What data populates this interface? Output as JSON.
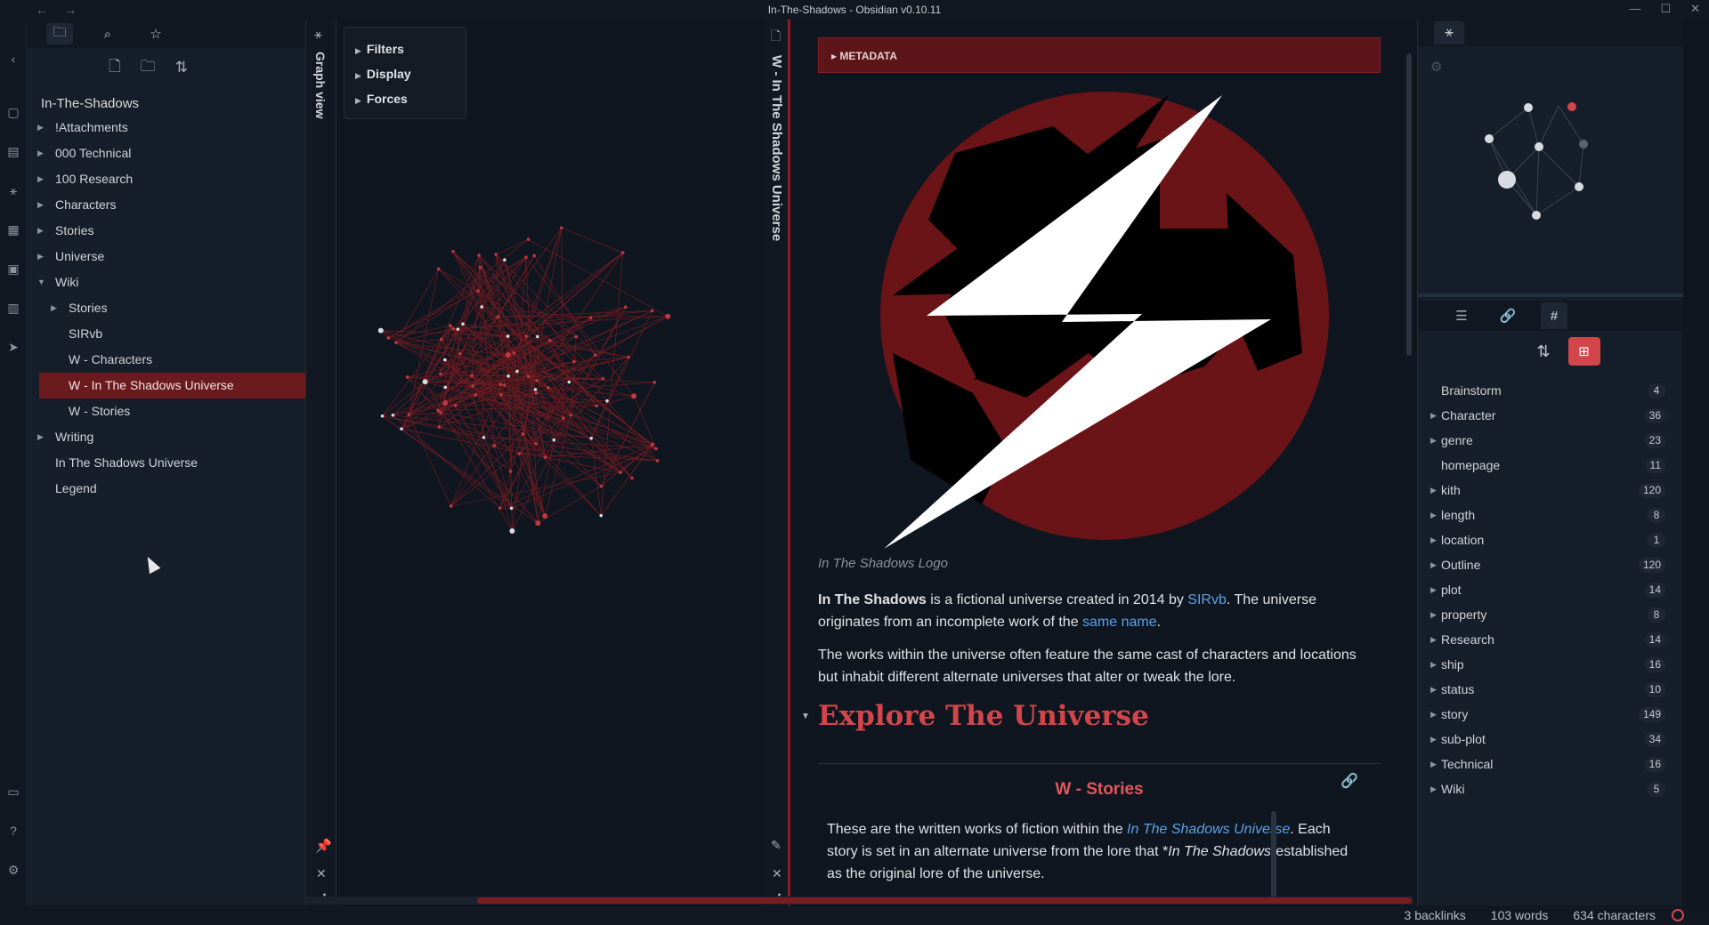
{
  "window": {
    "title": "In-The-Shadows - Obsidian v0.10.11",
    "nav_back": "←",
    "nav_forward": "→",
    "minimize": "—",
    "maximize": "☐",
    "close": "✕"
  },
  "ribbon": {
    "icons": [
      "chevron-left-icon",
      "calendar-icon",
      "document-icon",
      "graph-icon",
      "plugin-icon",
      "template-icon",
      "kanban-icon",
      "publish-icon",
      "vault-icon",
      "help-icon",
      "settings-icon"
    ]
  },
  "left_panel": {
    "tabs": [
      "file-explorer",
      "search",
      "starred"
    ],
    "vault_name": "In-The-Shadows",
    "tree": [
      {
        "label": "!Attachments",
        "level": 1,
        "folder": true,
        "expanded": false
      },
      {
        "label": "000 Technical",
        "level": 1,
        "folder": true,
        "expanded": false
      },
      {
        "label": "100 Research",
        "level": 1,
        "folder": true,
        "expanded": false
      },
      {
        "label": "Characters",
        "level": 1,
        "folder": true,
        "expanded": false
      },
      {
        "label": "Stories",
        "level": 1,
        "folder": true,
        "expanded": false
      },
      {
        "label": "Universe",
        "level": 1,
        "folder": true,
        "expanded": false
      },
      {
        "label": "Wiki",
        "level": 1,
        "folder": true,
        "expanded": true
      },
      {
        "label": "Stories",
        "level": 2,
        "folder": true,
        "expanded": false
      },
      {
        "label": "SIRvb",
        "level": 2,
        "folder": false
      },
      {
        "label": "W - Characters",
        "level": 2,
        "folder": false
      },
      {
        "label": "W - In The Shadows Universe",
        "level": 2,
        "folder": false,
        "active": true
      },
      {
        "label": "W - Stories",
        "level": 2,
        "folder": false
      },
      {
        "label": "Writing",
        "level": 1,
        "folder": true,
        "expanded": false
      },
      {
        "label": "In The Shadows Universe",
        "level": 1,
        "folder": false
      },
      {
        "label": "Legend",
        "level": 1,
        "folder": false
      }
    ]
  },
  "graph_view": {
    "title": "Graph view",
    "controls": [
      "Filters",
      "Display",
      "Forces"
    ]
  },
  "note": {
    "tab_title": "W - In The Shadows Universe",
    "metadata_label": "METADATA",
    "image_caption": "In The Shadows Logo",
    "p1": {
      "bold": "In The Shadows",
      "t1": " is a fictional universe created in 2014 by ",
      "link1": "SIRvb",
      "t2": ". The universe originates from an incomplete work of the ",
      "link2": "same name",
      "t3": "."
    },
    "p2": "The works within the universe often feature the same cast of characters and locations but inhabit different alternate universes that alter or tweak the lore.",
    "h1": "Explore The Universe",
    "embed_title": "W - Stories",
    "p3": {
      "t1": "These are the written works of fiction within the ",
      "link": "In The Shadows Universe",
      "t2": ". Each story is set in an alternate universe from the lore that *",
      "em": "In The Shadows",
      "t3": "-established as the original lore of the universe."
    }
  },
  "right_panel": {
    "tags_title": "Tags",
    "tags": [
      {
        "name": "Brainstorm",
        "count": "4",
        "expandable": false
      },
      {
        "name": "Character",
        "count": "36",
        "expandable": true
      },
      {
        "name": "genre",
        "count": "23",
        "expandable": true
      },
      {
        "name": "homepage",
        "count": "11",
        "expandable": false
      },
      {
        "name": "kith",
        "count": "120",
        "expandable": true
      },
      {
        "name": "length",
        "count": "8",
        "expandable": true
      },
      {
        "name": "location",
        "count": "1",
        "expandable": true
      },
      {
        "name": "Outline",
        "count": "120",
        "expandable": true
      },
      {
        "name": "plot",
        "count": "14",
        "expandable": true
      },
      {
        "name": "property",
        "count": "8",
        "expandable": true
      },
      {
        "name": "Research",
        "count": "14",
        "expandable": true
      },
      {
        "name": "ship",
        "count": "16",
        "expandable": true
      },
      {
        "name": "status",
        "count": "10",
        "expandable": true
      },
      {
        "name": "story",
        "count": "149",
        "expandable": true
      },
      {
        "name": "sub-plot",
        "count": "34",
        "expandable": true
      },
      {
        "name": "Technical",
        "count": "16",
        "expandable": true
      },
      {
        "name": "Wiki",
        "count": "5",
        "expandable": true
      }
    ]
  },
  "status_bar": {
    "backlinks": "3 backlinks",
    "words": "103 words",
    "characters": "634 characters"
  },
  "colors": {
    "accent": "#d2454b",
    "active_bg": "#6b1a1e",
    "link": "#5aa0e6"
  }
}
